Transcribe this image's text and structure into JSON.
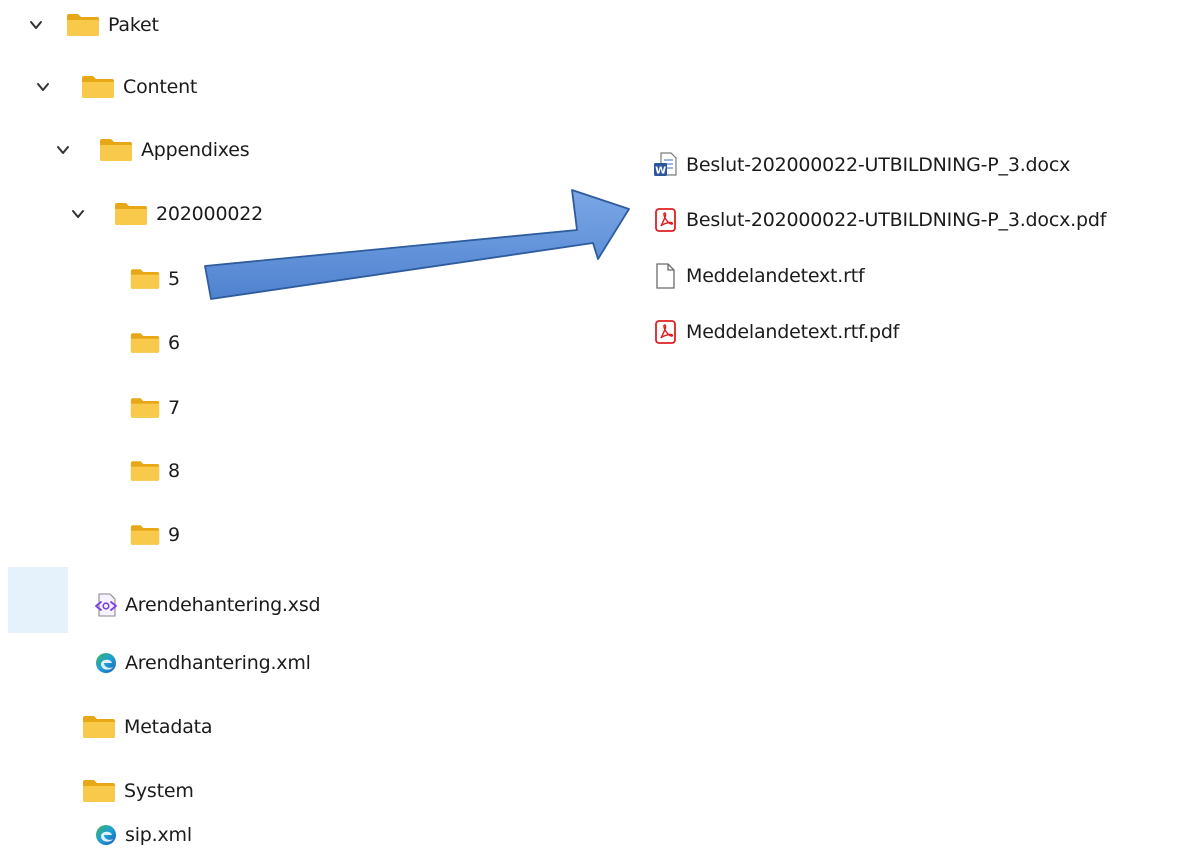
{
  "tree": {
    "paket": "Paket",
    "content": "Content",
    "appendixes": "Appendixes",
    "case_folder": "202000022",
    "subfolders": [
      "5",
      "6",
      "7",
      "8",
      "9"
    ],
    "xsd_file": "Arendehantering.xsd",
    "xml_file": "Arendhantering.xml",
    "metadata": "Metadata",
    "system": "System",
    "sip_file": "sip.xml"
  },
  "folder_contents": [
    {
      "name": "Beslut-202000022-UTBILDNING-P_3.docx",
      "icon": "word-doc-icon"
    },
    {
      "name": "Beslut-202000022-UTBILDNING-P_3.docx.pdf",
      "icon": "pdf-icon"
    },
    {
      "name": "Meddelandetext.rtf",
      "icon": "blank-file-icon"
    },
    {
      "name": "Meddelandetext.rtf.pdf",
      "icon": "pdf-icon"
    }
  ],
  "colors": {
    "folder": "#f8c94a",
    "folder_dark": "#e6a817",
    "arrow_fill": "#5b8fd6",
    "arrow_stroke": "#2e5c9e",
    "pdf_red": "#e02020",
    "word_blue": "#2b579a",
    "xsd_purple": "#7b3fe4",
    "edge_blue": "#1f7ad1",
    "edge_green": "#38b45a"
  }
}
